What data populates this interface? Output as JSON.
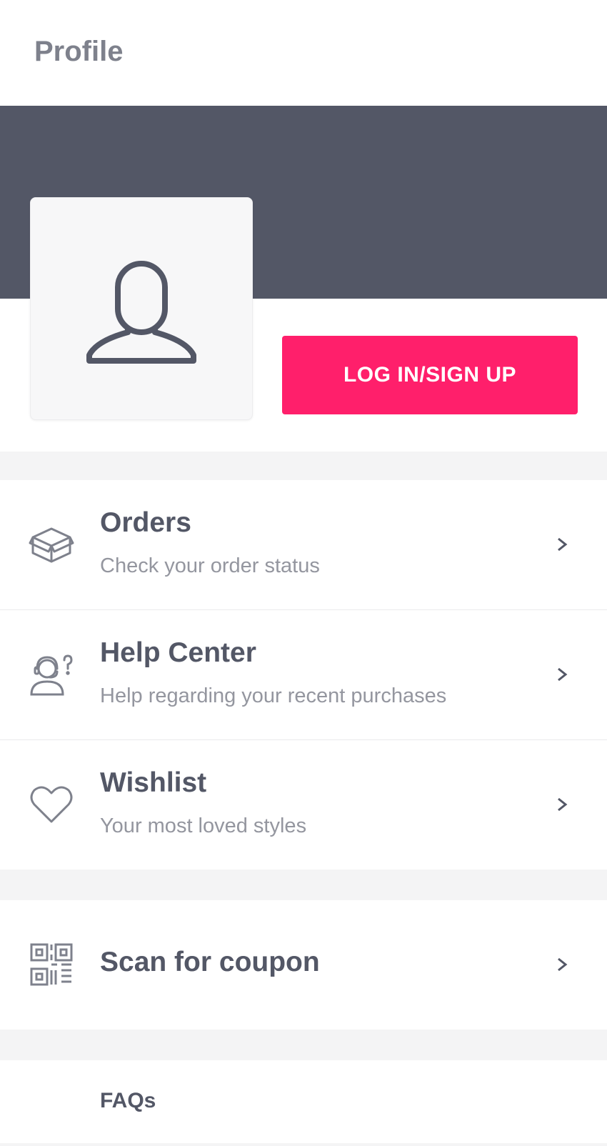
{
  "header": {
    "title": "Profile"
  },
  "profile": {
    "login_label": "LOG IN/SIGN UP"
  },
  "menu": [
    {
      "label": "Orders",
      "subtitle": "Check your order status",
      "icon": "box-icon"
    },
    {
      "label": "Help Center",
      "subtitle": "Help regarding your recent purchases",
      "icon": "support-agent-icon"
    },
    {
      "label": "Wishlist",
      "subtitle": "Your most loved styles",
      "icon": "heart-icon"
    }
  ],
  "coupon": {
    "label": "Scan for coupon",
    "icon": "qr-code-icon"
  },
  "faq": {
    "label": "FAQs"
  },
  "colors": {
    "accent": "#ff1f6b",
    "banner": "#535766",
    "text_primary": "#535766",
    "text_secondary": "#94969f"
  }
}
